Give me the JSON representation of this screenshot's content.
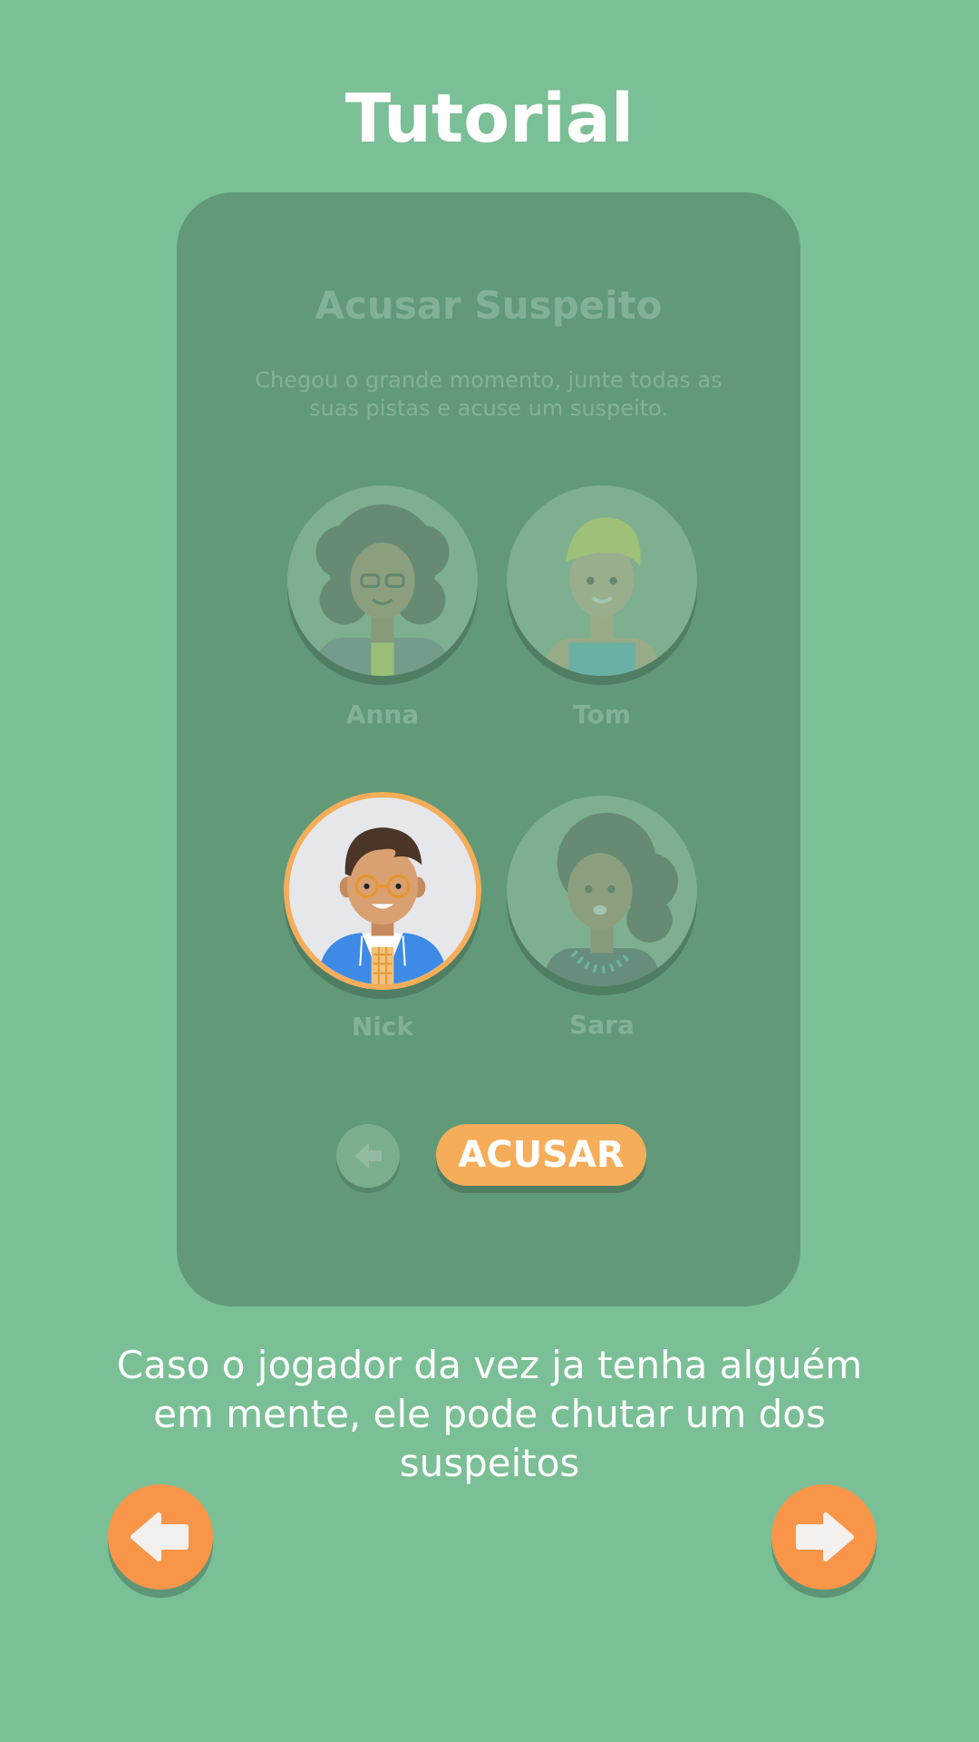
{
  "header": {
    "title": "Tutorial"
  },
  "card": {
    "title": "Acusar Suspeito",
    "description": "Chegou o grande momento, junte todas as suas pistas e acuse um suspeito.",
    "suspects": [
      {
        "name": "Anna",
        "selected": false
      },
      {
        "name": "Tom",
        "selected": false
      },
      {
        "name": "Nick",
        "selected": true
      },
      {
        "name": "Sara",
        "selected": false
      }
    ],
    "accuse_label": "ACUSAR",
    "back_icon": "arrow-left-icon"
  },
  "tutorial": {
    "caption": "Caso o jogador da vez ja tenha alguém em mente, ele pode chutar um dos suspeitos"
  },
  "navigation": {
    "prev_icon": "arrow-left-icon",
    "next_icon": "arrow-right-icon"
  },
  "colors": {
    "background": "#7bbf96",
    "card": "#629a79",
    "accent_orange": "#f5ad5a",
    "nav_orange": "#f99549"
  }
}
